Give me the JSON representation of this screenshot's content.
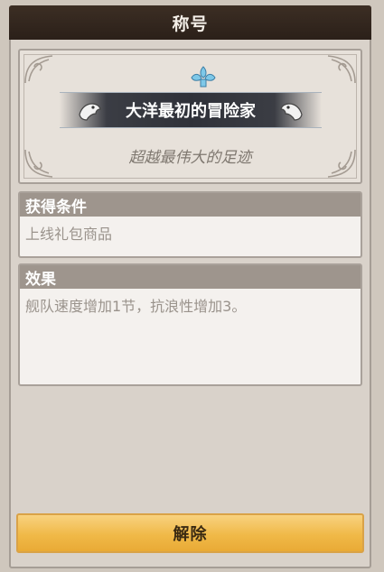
{
  "header": {
    "title": "称号"
  },
  "title_card": {
    "name": "大洋最初的冒险家",
    "subtitle": "超越最伟大的足迹"
  },
  "condition": {
    "heading": "获得条件",
    "text": "上线礼包商品"
  },
  "effect": {
    "heading": "效果",
    "text": "舰队速度增加1节，抗浪性增加3。"
  },
  "actions": {
    "dismiss_label": "解除"
  },
  "colors": {
    "header_bg": "#2b2019",
    "panel_bg": "#d9d2ca",
    "section_header_bg": "#9e958d",
    "button_gold": "#f0b948",
    "ornament_blue": "#7ec8e8"
  },
  "icons": {
    "banner_left": "ship-figurehead-icon",
    "banner_right": "ship-figurehead-icon",
    "top": "fleur-ornament-icon"
  }
}
